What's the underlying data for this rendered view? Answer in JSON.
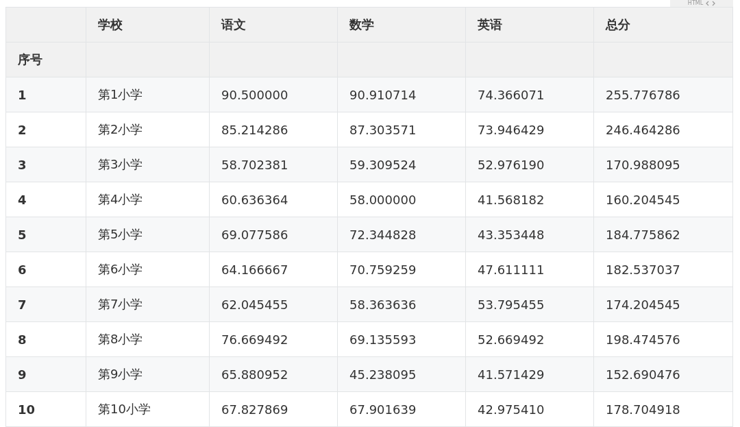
{
  "tab": {
    "label": "HTML"
  },
  "table": {
    "columns": [
      "学校",
      "语文",
      "数学",
      "英语",
      "总分"
    ],
    "index_name": "序号",
    "rows": [
      {
        "index": "1",
        "cells": [
          "第1小学",
          "90.500000",
          "90.910714",
          "74.366071",
          "255.776786"
        ]
      },
      {
        "index": "2",
        "cells": [
          "第2小学",
          "85.214286",
          "87.303571",
          "73.946429",
          "246.464286"
        ]
      },
      {
        "index": "3",
        "cells": [
          "第3小学",
          "58.702381",
          "59.309524",
          "52.976190",
          "170.988095"
        ]
      },
      {
        "index": "4",
        "cells": [
          "第4小学",
          "60.636364",
          "58.000000",
          "41.568182",
          "160.204545"
        ]
      },
      {
        "index": "5",
        "cells": [
          "第5小学",
          "69.077586",
          "72.344828",
          "43.353448",
          "184.775862"
        ]
      },
      {
        "index": "6",
        "cells": [
          "第6小学",
          "64.166667",
          "70.759259",
          "47.611111",
          "182.537037"
        ]
      },
      {
        "index": "7",
        "cells": [
          "第7小学",
          "62.045455",
          "58.363636",
          "53.795455",
          "174.204545"
        ]
      },
      {
        "index": "8",
        "cells": [
          "第8小学",
          "76.669492",
          "69.135593",
          "52.669492",
          "198.474576"
        ]
      },
      {
        "index": "9",
        "cells": [
          "第9小学",
          "65.880952",
          "45.238095",
          "41.571429",
          "152.690476"
        ]
      },
      {
        "index": "10",
        "cells": [
          "第10小学",
          "67.827869",
          "67.901639",
          "42.975410",
          "178.704918"
        ]
      }
    ]
  }
}
